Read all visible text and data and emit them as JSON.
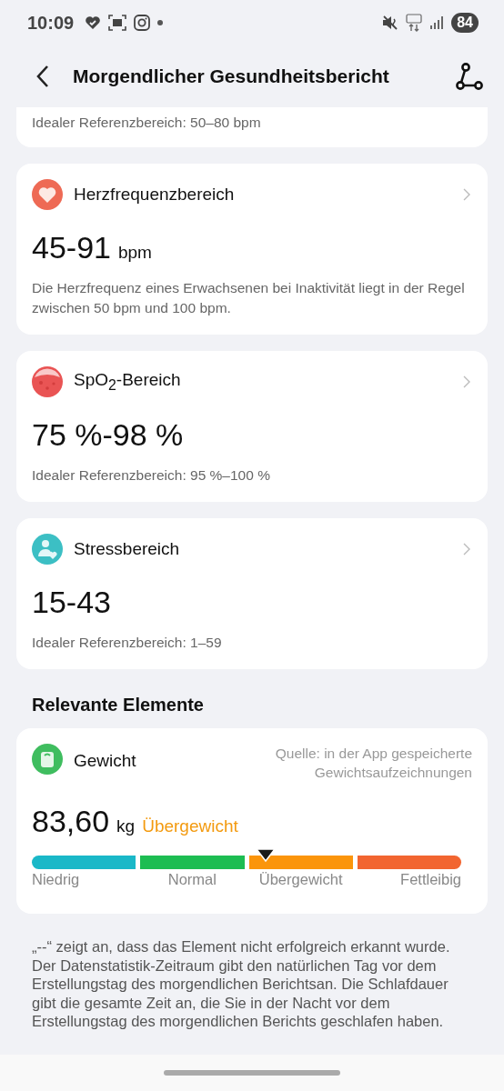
{
  "status_bar": {
    "time": "10:09",
    "battery": "84"
  },
  "header": {
    "title": "Morgendlicher Gesundheitsbericht"
  },
  "partial_card": {
    "reference": "Idealer Referenzbereich: 50–80 bpm"
  },
  "cards": [
    {
      "kind": "heart",
      "title": "Herzfrequenzbereich",
      "value": "45-91",
      "unit": "bpm",
      "note": "Die Herzfrequenz eines Erwachsenen bei Inaktivität liegt in der Regel zwischen 50 bpm und 100 bpm."
    },
    {
      "kind": "spo2",
      "title": "SpO$_{2}$-Bereich",
      "value": "75 %-98 %",
      "note": "Idealer Referenzbereich: 95 %–100 %"
    },
    {
      "kind": "stress",
      "title": "Stressbereich",
      "value": "15-43",
      "note": "Idealer Referenzbereich: 1–59"
    }
  ],
  "related": {
    "heading": "Relevante Elemente",
    "weight": {
      "title": "Gewicht",
      "source": "Quelle: in der App gespeicherte Gewichtsaufzeichnungen",
      "value": "83,60",
      "unit": "kg",
      "status": "Übergewicht",
      "scale": {
        "level": 0.53,
        "segments": [
          {
            "label": "Niedrig",
            "color": "#1ab8c8"
          },
          {
            "label": "Normal",
            "color": "#1dbd52"
          },
          {
            "label": "Übergewicht",
            "color": "#fb950b"
          },
          {
            "label": "Fettleibig",
            "color": "#f26530"
          }
        ]
      }
    }
  },
  "footnote": "„--“ zeigt an, dass das Element nicht erfolgreich erkannt wurde. Der Datenstatistik-Zeitraum gibt den natürlichen Tag vor dem Erstellungstag des morgendlichen Berichtsan. Die Schlafdauer gibt die gesamte Zeit an, die Sie in der Nacht vor dem Erstellungstag des morgendlichen Berichts geschlafen haben."
}
